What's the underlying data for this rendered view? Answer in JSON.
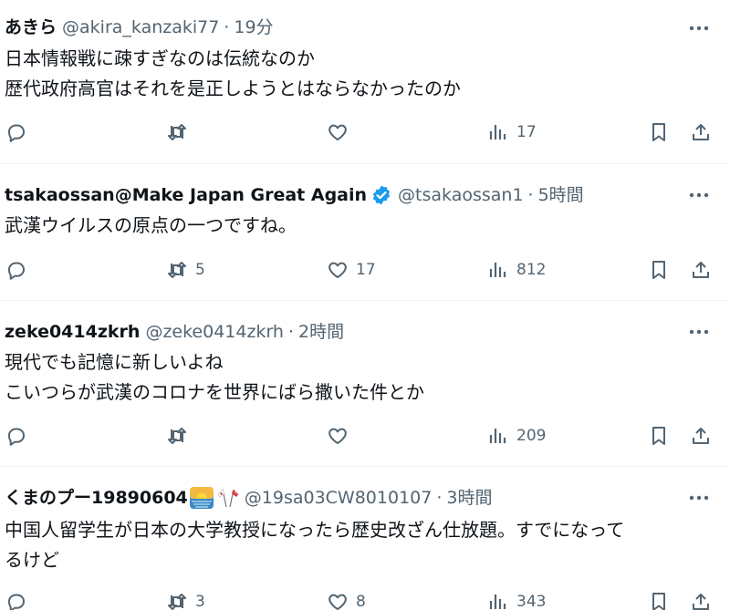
{
  "tweets": [
    {
      "name": "あきら",
      "handle": "@akira_kanzaki77",
      "time": "19分",
      "body": "日本情報戦に疎すぎなのは伝統なのか\n歴代政府高官はそれを是正しようとはならなかったのか",
      "replies": "",
      "retweets": "",
      "likes": "",
      "views": "17"
    },
    {
      "name": "tsakaossan@Make Japan Great Again",
      "verified": true,
      "handle": "@tsakaossan1",
      "time": "5時間",
      "body": "武漢ウイルスの原点の一つですね。",
      "replies": "",
      "retweets": "5",
      "likes": "17",
      "views": "812"
    },
    {
      "name": "zeke0414zkrh",
      "handle": "@zeke0414zkrh",
      "time": "2時間",
      "body": "現代でも記憶に新しいよね\nこいつらが武漢のコロナを世界にばら撒いた件とか",
      "replies": "",
      "retweets": "",
      "likes": "",
      "views": "209"
    },
    {
      "name": "くまのプー19890604",
      "name_emojis": [
        "sunrise-over-sea-emoji",
        "japan-china-flags-emoji"
      ],
      "handle": "@19sa03CW8010107",
      "time": "3時間",
      "body": "中国人留学生が日本の大学教授になったら歴史改ざん仕放題。すでになって\nるけど",
      "replies": "",
      "retweets": "3",
      "likes": "8",
      "views": "343"
    }
  ],
  "icons": {
    "reply": "reply-icon",
    "retweet": "retweet-icon",
    "like": "heart-icon",
    "views": "views-icon",
    "bookmark": "bookmark-icon",
    "share": "share-icon",
    "more": "more-icon",
    "verified": "verified-badge-icon"
  },
  "colors": {
    "text": "#0f1419",
    "secondary": "#536471",
    "verified": "#1d9bf0",
    "divider": "#eff3f4"
  }
}
